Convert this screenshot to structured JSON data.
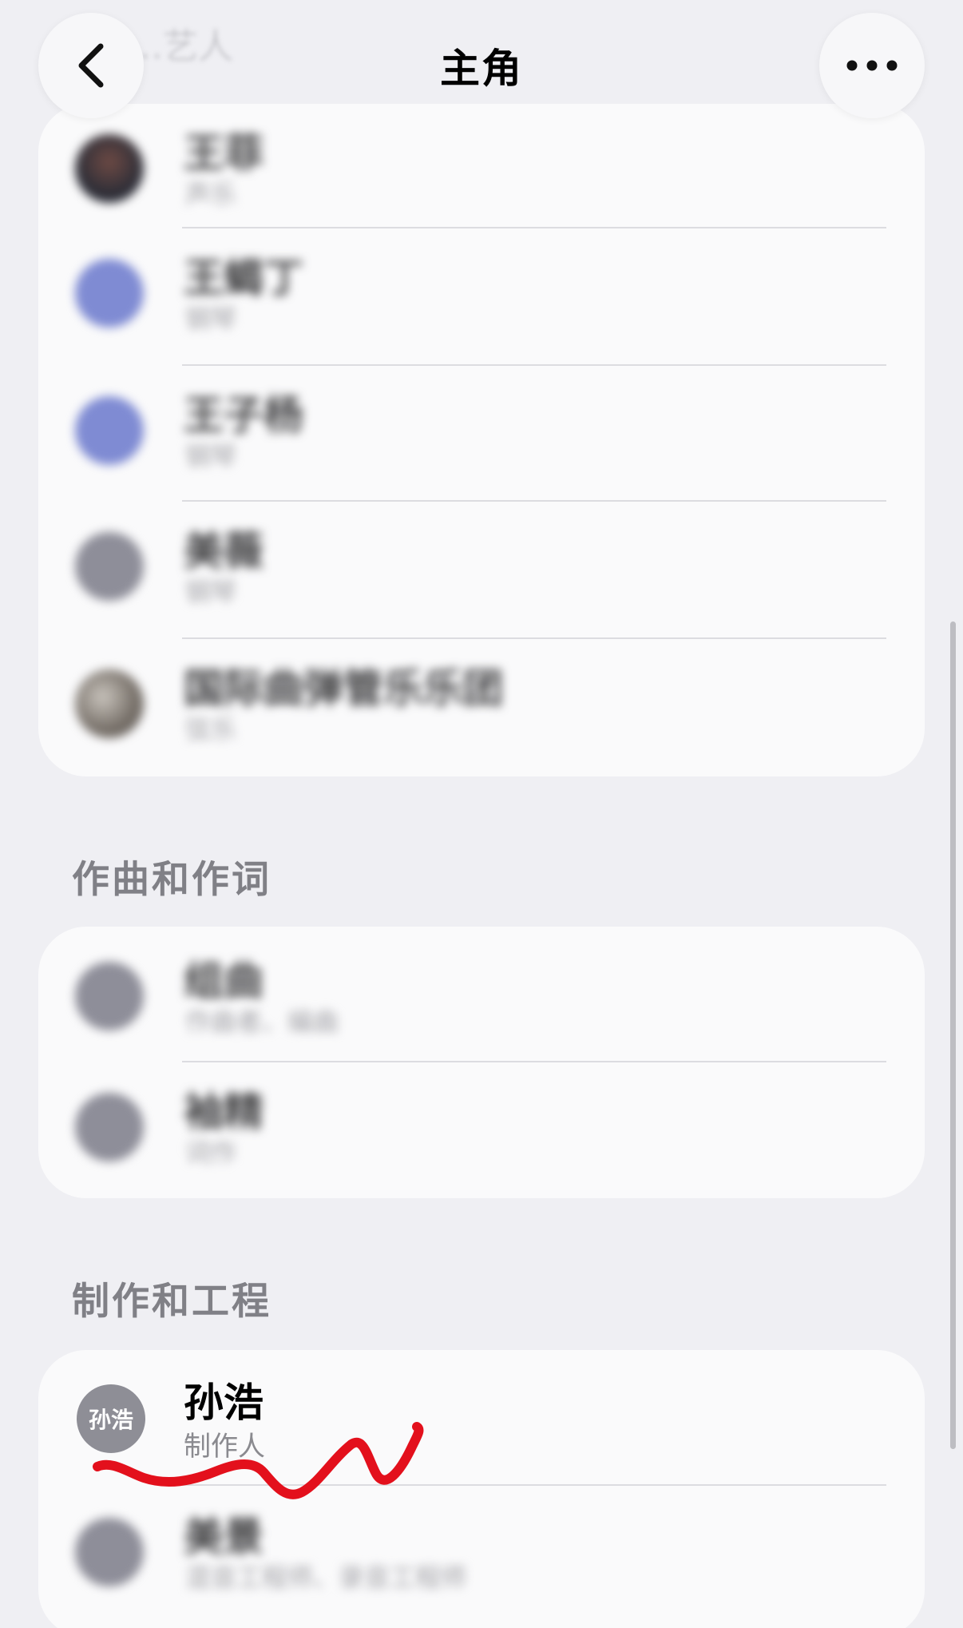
{
  "nav": {
    "title": "主角",
    "faded_section_header": "…艺人"
  },
  "sections": [
    {
      "label": "",
      "rows": [
        {
          "name": "王菲",
          "role": "声乐",
          "avatar": "photo"
        },
        {
          "name": "王蝎丁",
          "role": "钢琴",
          "avatar": "blue"
        },
        {
          "name": "王子杨",
          "role": "钢琴",
          "avatar": "blue"
        },
        {
          "name": "美薇",
          "role": "钢琴",
          "avatar": "grey"
        },
        {
          "name": "国际曲弹管乐乐团",
          "role": "弦乐",
          "avatar": "photo"
        }
      ]
    },
    {
      "label": "作曲和作词",
      "rows": [
        {
          "name": "组曲",
          "role": "作曲者、编曲",
          "avatar": "grey"
        },
        {
          "name": "袖精",
          "role": "词作",
          "avatar": "grey"
        }
      ]
    },
    {
      "label": "制作和工程",
      "rows": [
        {
          "name": "孙浩",
          "role": "制作人",
          "initials": "孙浩",
          "avatar": "grey"
        },
        {
          "name": "美景",
          "role": "混音工程师、录音工程师",
          "avatar": "grey"
        }
      ]
    }
  ],
  "icons": {
    "back": "chevron-left-icon",
    "more": "ellipsis-icon"
  },
  "colors": {
    "background": "#efeff3",
    "card": "#fafafb",
    "scribble": "#e3101c"
  }
}
